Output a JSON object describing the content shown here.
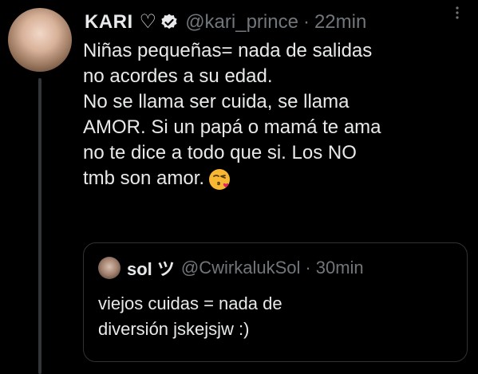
{
  "tweet": {
    "display_name": "KARI",
    "handle": "@kari_prince",
    "separator": "·",
    "time": "22min",
    "more_icon": "more-dots-icon",
    "text_lines": [
      "Niñas pequeñas= nada de salidas",
      "no acordes a su edad.",
      "No se llama ser cuida, se llama",
      "AMOR. Si un papá o mamá te ama",
      "no te dice a todo que si. Los NO",
      "tmb son amor."
    ],
    "emoji": "face-blowing-kiss-emoji"
  },
  "quote": {
    "display_name": "sol ツ",
    "handle": "@CwirkalukSol",
    "separator": "·",
    "time": "30min",
    "text_lines": [
      "viejos cuidas = nada de",
      "diversión jskejsjw :)"
    ]
  },
  "colors": {
    "background": "#000000",
    "text": "#e7e9ea",
    "muted": "#71767b",
    "border": "#2f3336",
    "thread_line": "#333639",
    "verified": "#e7e9ea"
  }
}
